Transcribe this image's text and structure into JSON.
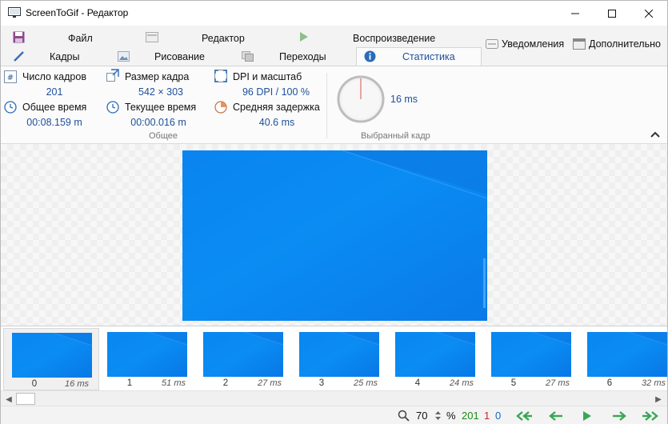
{
  "window": {
    "title": "ScreenToGif - Редактор"
  },
  "tabs": {
    "file": "Файл",
    "editor": "Редактор",
    "playback": "Воспроизведение",
    "frames": "Кадры",
    "drawing": "Рисование",
    "transitions": "Переходы",
    "statistics": "Статистика",
    "notifications": "Уведомления",
    "extras": "Дополнительно"
  },
  "stats": {
    "frame_count_label": "Число кадров",
    "frame_count": "201",
    "frame_size_label": "Размер кадра",
    "frame_size": "542 × 303",
    "dpi_label": "DPI и масштаб",
    "dpi": "96 DPI / 100 %",
    "total_time_label": "Общее время",
    "total_time": "00:08.159 m",
    "current_time_label": "Текущее время",
    "current_time": "00:00.016 m",
    "avg_delay_label": "Средняя задержка",
    "avg_delay": "40.6 ms",
    "group_general": "Общее",
    "selected_delay": "16 ms",
    "group_selected": "Выбранный кадр"
  },
  "thumbnails": [
    {
      "num": "0",
      "dur": "16 ms",
      "selected": true
    },
    {
      "num": "1",
      "dur": "51 ms"
    },
    {
      "num": "2",
      "dur": "27 ms"
    },
    {
      "num": "3",
      "dur": "25 ms"
    },
    {
      "num": "4",
      "dur": "24 ms"
    },
    {
      "num": "5",
      "dur": "27 ms"
    },
    {
      "num": "6",
      "dur": "32 ms"
    }
  ],
  "status": {
    "zoom": "70",
    "zoom_unit": "%",
    "total_frames": "201",
    "selected_frames": "1",
    "current_frame": "0"
  },
  "colors": {
    "accent_blue": "#1e4f9c",
    "total_green": "#1a8a1a",
    "selected_red": "#c62828",
    "current_blue": "#1565c0",
    "nav_green": "#3aa655"
  }
}
